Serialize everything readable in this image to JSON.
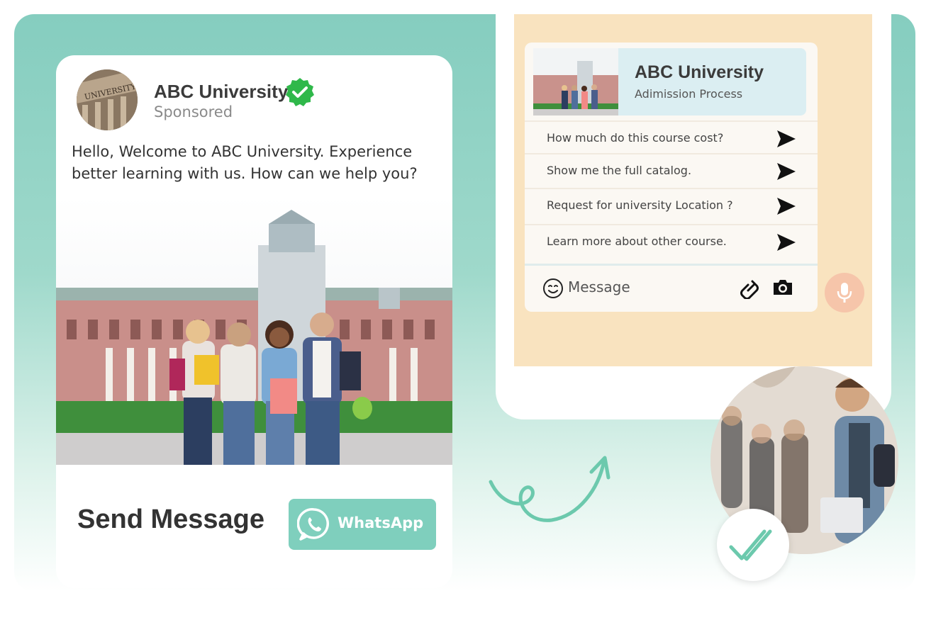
{
  "ad": {
    "brand": "ABC University",
    "sponsored": "Sponsored",
    "message": "Hello, Welcome to ABC University. Experience better learning with us. How can we help you?",
    "cta_label": "Send Message",
    "button_label": "WhatsApp"
  },
  "chat": {
    "title": "ABC University",
    "subtitle": "Adimission Process",
    "quick_replies": [
      "How much do this course cost?",
      "Show me the full catalog.",
      "Request for university Location ?",
      "Learn more about other course."
    ],
    "message_placeholder": "Message"
  },
  "colors": {
    "accent": "#7fcfbd",
    "background_top": "#85cdbf",
    "phone_screen": "#f9e3bf",
    "verified": "#2fb84a",
    "mic": "#f6c5aa"
  },
  "icons": [
    "verified-badge-icon",
    "whatsapp-icon",
    "send-icon",
    "emoji-icon",
    "attach-icon",
    "camera-icon",
    "mic-icon",
    "double-check-icon",
    "curly-arrow"
  ]
}
